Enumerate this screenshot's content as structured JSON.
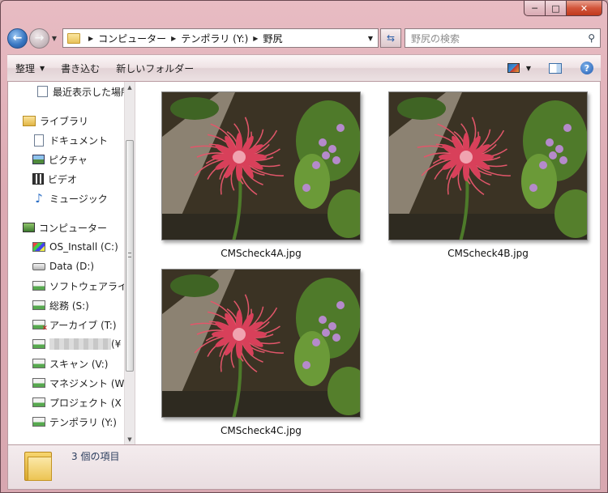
{
  "window": {
    "caption": {
      "minimize": "─",
      "maximize": "□",
      "close": "✕"
    }
  },
  "nav": {
    "back_icon": "back-arrow-icon",
    "forward_icon": "forward-arrow-icon",
    "breadcrumb": [
      "コンピューター",
      "テンポラリ (Y:)",
      "野尻"
    ],
    "refresh_icon": "refresh-icon",
    "search_placeholder": "野尻の検索"
  },
  "toolbar": {
    "organize_label": "整理",
    "burn_label": "書き込む",
    "new_folder_label": "新しいフォルダー"
  },
  "sidebar": {
    "items": [
      {
        "label": "最近表示した場所",
        "icon": "recent-places-icon",
        "level": 2
      },
      {
        "label": "ライブラリ",
        "icon": "library-icon",
        "level": 1
      },
      {
        "label": "ドキュメント",
        "icon": "documents-icon",
        "level": 2
      },
      {
        "label": "ピクチャ",
        "icon": "pictures-icon",
        "level": 2
      },
      {
        "label": "ビデオ",
        "icon": "videos-icon",
        "level": 2
      },
      {
        "label": "ミュージック",
        "icon": "music-icon",
        "level": 2
      },
      {
        "label": "コンピューター",
        "icon": "computer-icon",
        "level": 1
      },
      {
        "label": "OS_Install (C:)",
        "icon": "os-drive-icon",
        "level": 2
      },
      {
        "label": "Data (D:)",
        "icon": "drive-icon",
        "level": 2
      },
      {
        "label": "ソフトウェアライ",
        "icon": "network-drive-icon",
        "level": 2
      },
      {
        "label": "総務 (S:)",
        "icon": "network-drive-icon",
        "level": 2
      },
      {
        "label": "アーカイブ (T:)",
        "icon": "disconnected-drive-icon",
        "level": 2
      },
      {
        "label": "(¥",
        "icon": "network-drive-icon",
        "level": 2
      },
      {
        "label": "スキャン (V:)",
        "icon": "network-drive-icon",
        "level": 2
      },
      {
        "label": "マネジメント (W",
        "icon": "network-drive-icon",
        "level": 2
      },
      {
        "label": "プロジェクト (X",
        "icon": "network-drive-icon",
        "level": 2
      },
      {
        "label": "テンポラリ (Y:)",
        "icon": "network-drive-icon",
        "level": 2
      }
    ]
  },
  "files": [
    {
      "name": "CMScheck4A.jpg",
      "icon": "spider-lily-photo"
    },
    {
      "name": "CMScheck4B.jpg",
      "icon": "spider-lily-photo"
    },
    {
      "name": "CMScheck4C.jpg",
      "icon": "spider-lily-photo"
    }
  ],
  "status": {
    "item_count": "3 個の項目"
  },
  "colors": {
    "frame": "#dcaab3",
    "close_button": "#c0391d",
    "accent": "#2c5fa8"
  }
}
